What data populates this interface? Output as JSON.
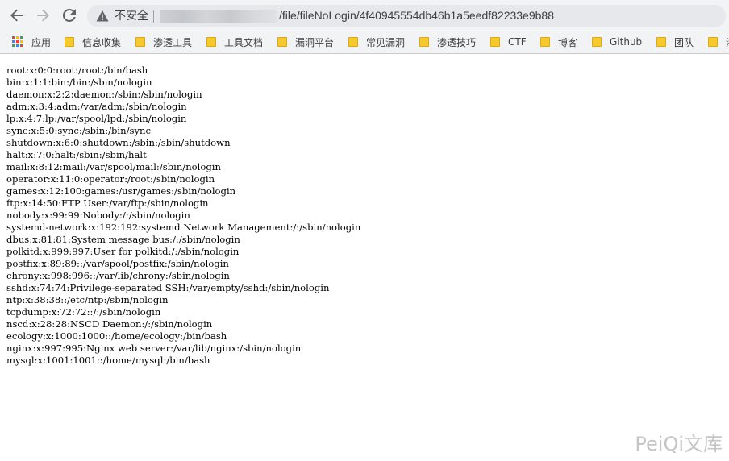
{
  "toolbar": {
    "back_icon": "arrow-left-icon",
    "forward_icon": "arrow-right-icon",
    "reload_icon": "reload-icon",
    "security_icon": "warning-triangle-icon",
    "security_label": "不安全",
    "url_path": "/file/fileNoLogin/4f40945554db46b1a5eedf82233e9b88"
  },
  "bookmarks": [
    {
      "label": "应用",
      "icon": "apps-grid-icon"
    },
    {
      "label": "信息收集",
      "icon": "folder-icon"
    },
    {
      "label": "渗透工具",
      "icon": "folder-icon"
    },
    {
      "label": "工具文档",
      "icon": "folder-icon"
    },
    {
      "label": "漏洞平台",
      "icon": "folder-icon"
    },
    {
      "label": "常见漏洞",
      "icon": "folder-icon"
    },
    {
      "label": "渗透技巧",
      "icon": "folder-icon"
    },
    {
      "label": "CTF",
      "icon": "folder-icon"
    },
    {
      "label": "博客",
      "icon": "folder-icon"
    },
    {
      "label": "Github",
      "icon": "folder-icon"
    },
    {
      "label": "团队",
      "icon": "folder-icon"
    },
    {
      "label": "渗",
      "icon": "folder-icon"
    }
  ],
  "content_lines": [
    "root:x:0:0:root:/root:/bin/bash",
    "bin:x:1:1:bin:/bin:/sbin/nologin",
    "daemon:x:2:2:daemon:/sbin:/sbin/nologin",
    "adm:x:3:4:adm:/var/adm:/sbin/nologin",
    "lp:x:4:7:lp:/var/spool/lpd:/sbin/nologin",
    "sync:x:5:0:sync:/sbin:/bin/sync",
    "shutdown:x:6:0:shutdown:/sbin:/sbin/shutdown",
    "halt:x:7:0:halt:/sbin:/sbin/halt",
    "mail:x:8:12:mail:/var/spool/mail:/sbin/nologin",
    "operator:x:11:0:operator:/root:/sbin/nologin",
    "games:x:12:100:games:/usr/games:/sbin/nologin",
    "ftp:x:14:50:FTP User:/var/ftp:/sbin/nologin",
    "nobody:x:99:99:Nobody:/:/sbin/nologin",
    "systemd-network:x:192:192:systemd Network Management:/:/sbin/nologin",
    "dbus:x:81:81:System message bus:/:/sbin/nologin",
    "polkitd:x:999:997:User for polkitd:/:/sbin/nologin",
    "postfix:x:89:89::/var/spool/postfix:/sbin/nologin",
    "chrony:x:998:996::/var/lib/chrony:/sbin/nologin",
    "sshd:x:74:74:Privilege-separated SSH:/var/empty/sshd:/sbin/nologin",
    "ntp:x:38:38::/etc/ntp:/sbin/nologin",
    "tcpdump:x:72:72::/:/sbin/nologin",
    "nscd:x:28:28:NSCD Daemon:/:/sbin/nologin",
    "ecology:x:1000:1000::/home/ecology:/bin/bash",
    "nginx:x:997:995:Nginx web server:/var/lib/nginx:/sbin/nologin",
    "mysql:x:1001:1001::/home/mysql:/bin/bash"
  ],
  "watermark": "PeiQi文库",
  "colors": {
    "folder": "#f7c92f",
    "toolbar_bg": "#f1f3f4",
    "omnibox_bg": "#e6e8eb"
  }
}
